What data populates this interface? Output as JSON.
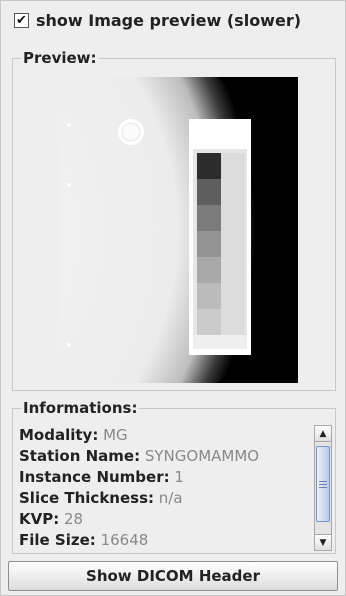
{
  "preview_checkbox": {
    "label": "show Image preview (slower)",
    "checked": true,
    "check_glyph": "✔"
  },
  "preview": {
    "legend": "Preview:"
  },
  "informations": {
    "legend": "Informations:",
    "items": [
      {
        "label": "Modality:",
        "value": "MG"
      },
      {
        "label": "Station Name:",
        "value": "SYNGOMAMMO"
      },
      {
        "label": "Instance Number:",
        "value": "1"
      },
      {
        "label": "Slice Thickness:",
        "value": "n/a"
      },
      {
        "label": "KVP:",
        "value": "28"
      },
      {
        "label": "File Size:",
        "value": "16648"
      }
    ]
  },
  "scrollbar": {
    "up_icon": "▲",
    "down_icon": "▼"
  },
  "button": {
    "label": "Show DICOM Header"
  }
}
